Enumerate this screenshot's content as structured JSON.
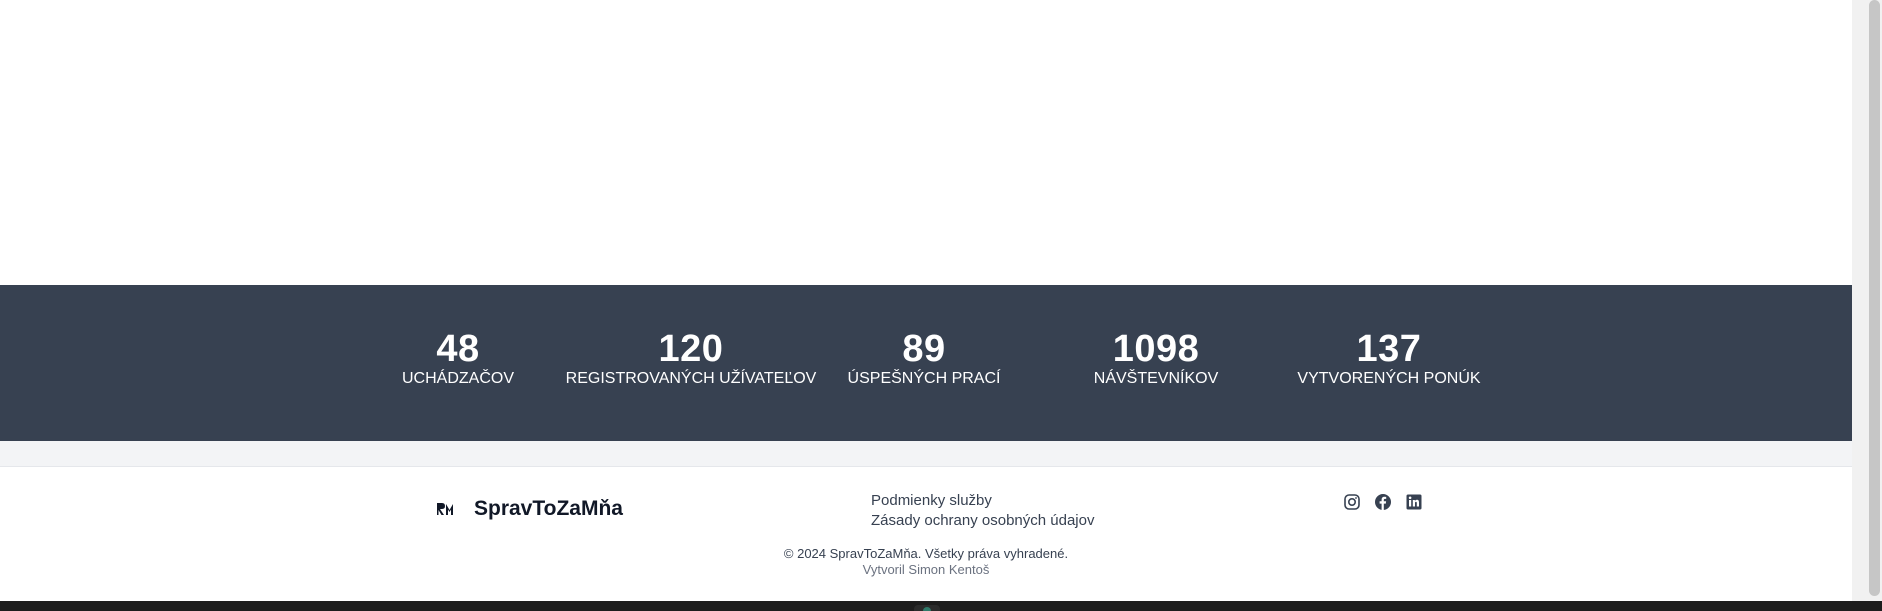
{
  "stats": [
    {
      "value": "48",
      "label": "UCHÁDZAČOV"
    },
    {
      "value": "120",
      "label": "REGISTROVANÝCH UŽÍVATEĽOV"
    },
    {
      "value": "89",
      "label": "ÚSPEŠNÝCH PRACÍ"
    },
    {
      "value": "1098",
      "label": "NÁVŠTEVNÍKOV"
    },
    {
      "value": "137",
      "label": "VYTVORENÝCH PONÚK"
    }
  ],
  "footer": {
    "brand_name": "SpravToZaMňa",
    "links": [
      "Podmienky služby",
      "Zásady ochrany osobných údajov"
    ],
    "social_icons": [
      "instagram-icon",
      "facebook-icon",
      "linkedin-icon"
    ],
    "copyright": "© 2024 SpravToZaMňa. Všetky práva vyhradené.",
    "credit": "Vytvoril Simon Kentoš"
  },
  "colors": {
    "stats_background": "#374151",
    "strip_background": "#f3f4f6",
    "footer_text": "#374151",
    "social_icon": "#374151"
  }
}
